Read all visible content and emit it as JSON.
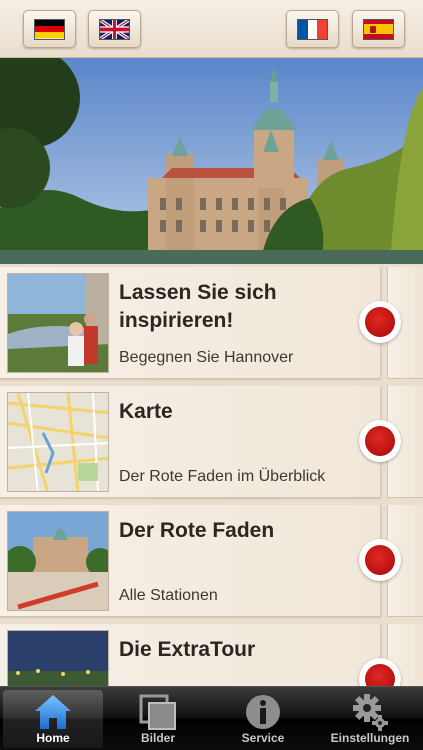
{
  "language_bar": {
    "flags": [
      {
        "id": "de",
        "icon": "german-flag-icon"
      },
      {
        "id": "gb",
        "icon": "british-flag-icon"
      },
      {
        "id": "fr",
        "icon": "french-flag-icon"
      },
      {
        "id": "es",
        "icon": "spanish-flag-icon"
      }
    ]
  },
  "hero": {
    "icon": "town-hall-photo"
  },
  "list": {
    "items": [
      {
        "title": "Lassen Sie sich inspirieren!",
        "subtitle": "Begegnen Sie Hannover",
        "icon": "inspiration-photo"
      },
      {
        "title": "Karte",
        "subtitle": "Der Rote Faden im Überblick",
        "icon": "map-thumbnail"
      },
      {
        "title": "Der Rote Faden",
        "subtitle": "Alle Stationen",
        "icon": "red-thread-photo"
      },
      {
        "title": "Die ExtraTour",
        "subtitle": "",
        "icon": "extratour-photo"
      }
    ]
  },
  "tabbar": {
    "tabs": [
      {
        "label": "Home",
        "icon": "home-icon",
        "active": true
      },
      {
        "label": "Bilder",
        "icon": "gallery-icon",
        "active": false
      },
      {
        "label": "Service",
        "icon": "info-icon",
        "active": false
      },
      {
        "label": "Einstellungen",
        "icon": "gear-icon",
        "active": false
      }
    ]
  },
  "colors": {
    "accent_red": "#c8191a",
    "tab_active_blue": "#2a8fe0",
    "background": "#efe4d6"
  }
}
